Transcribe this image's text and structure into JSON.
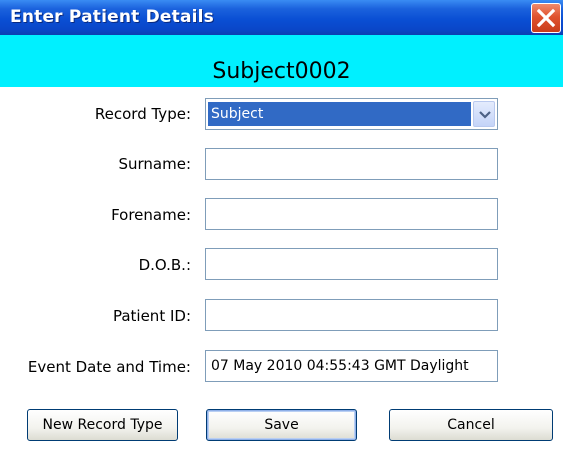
{
  "window": {
    "title": "Enter Patient Details"
  },
  "header": {
    "subject_title": "Subject0002",
    "banner_color": "#00f0ff"
  },
  "form": {
    "record_type": {
      "label": "Record Type:",
      "value": "Subject"
    },
    "surname": {
      "label": "Surname:",
      "value": ""
    },
    "forename": {
      "label": "Forename:",
      "value": ""
    },
    "dob": {
      "label": "D.O.B.:",
      "value": ""
    },
    "patient_id": {
      "label": "Patient ID:",
      "value": ""
    },
    "event_date": {
      "label": "Event Date and Time:",
      "value": "07 May 2010 04:55:43 GMT Daylight"
    }
  },
  "buttons": {
    "new_record_type": "New Record Type",
    "save": "Save",
    "cancel": "Cancel"
  },
  "icons": {
    "close": "close-icon",
    "dropdown": "chevron-down-icon"
  }
}
